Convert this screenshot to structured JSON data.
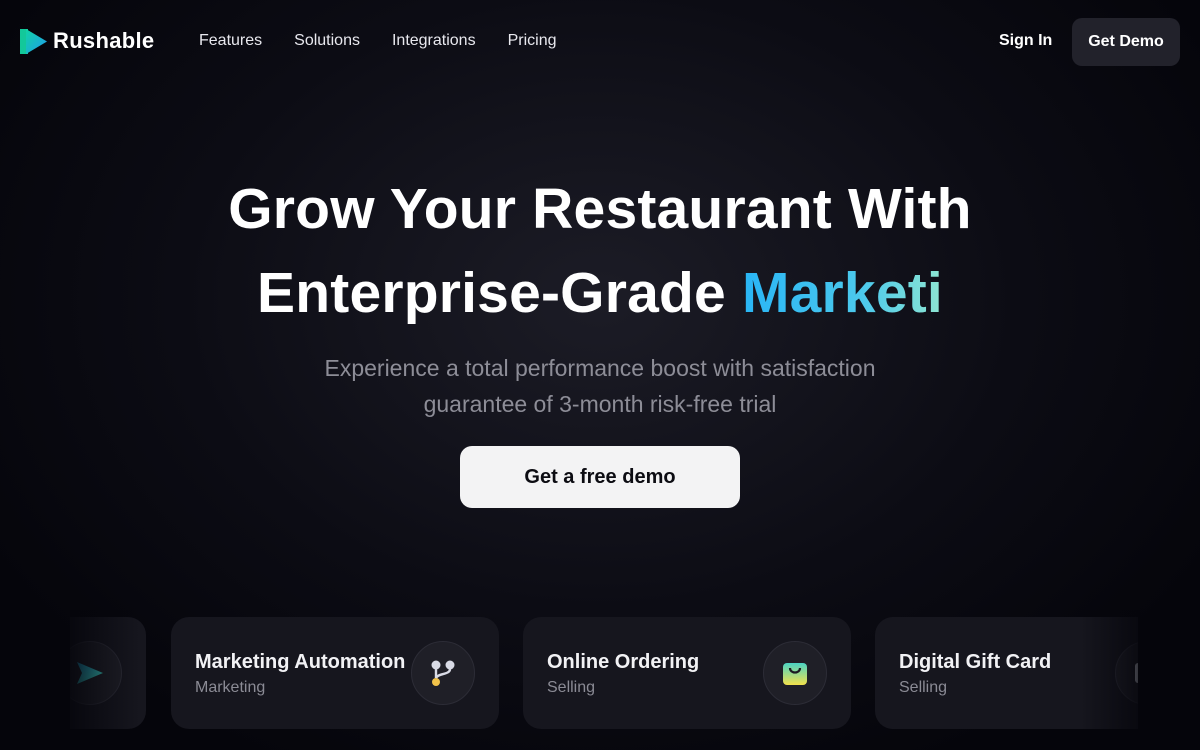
{
  "brand": {
    "name": "Rushable"
  },
  "nav": {
    "links": [
      "Features",
      "Solutions",
      "Integrations",
      "Pricing"
    ],
    "sign_in": "Sign In",
    "get_demo": "Get Demo"
  },
  "hero": {
    "line1": "Grow Your Restaurant With",
    "line2_prefix": "Enterprise-Grade ",
    "line2_accent": "Marketi",
    "subtitle_line1": "Experience a total performance boost with satisfaction",
    "subtitle_line2": "guarantee of 3-month risk-free trial",
    "cta": "Get a free demo"
  },
  "cards": [
    {
      "title": "",
      "subtitle": "",
      "icon": "send-icon"
    },
    {
      "title": "Marketing Automation",
      "subtitle": "Marketing",
      "icon": "branch-icon"
    },
    {
      "title": "Online Ordering",
      "subtitle": "Selling",
      "icon": "shopping-bag-icon"
    },
    {
      "title": "Digital Gift Card",
      "subtitle": "Selling",
      "icon": "gift-card-icon"
    }
  ],
  "colors": {
    "background": "#0c0c14",
    "accent_start": "#29b5f5",
    "accent_end": "#8ee6d2",
    "cta_bg": "#f3f3f4",
    "card_bg": "#16161e"
  }
}
